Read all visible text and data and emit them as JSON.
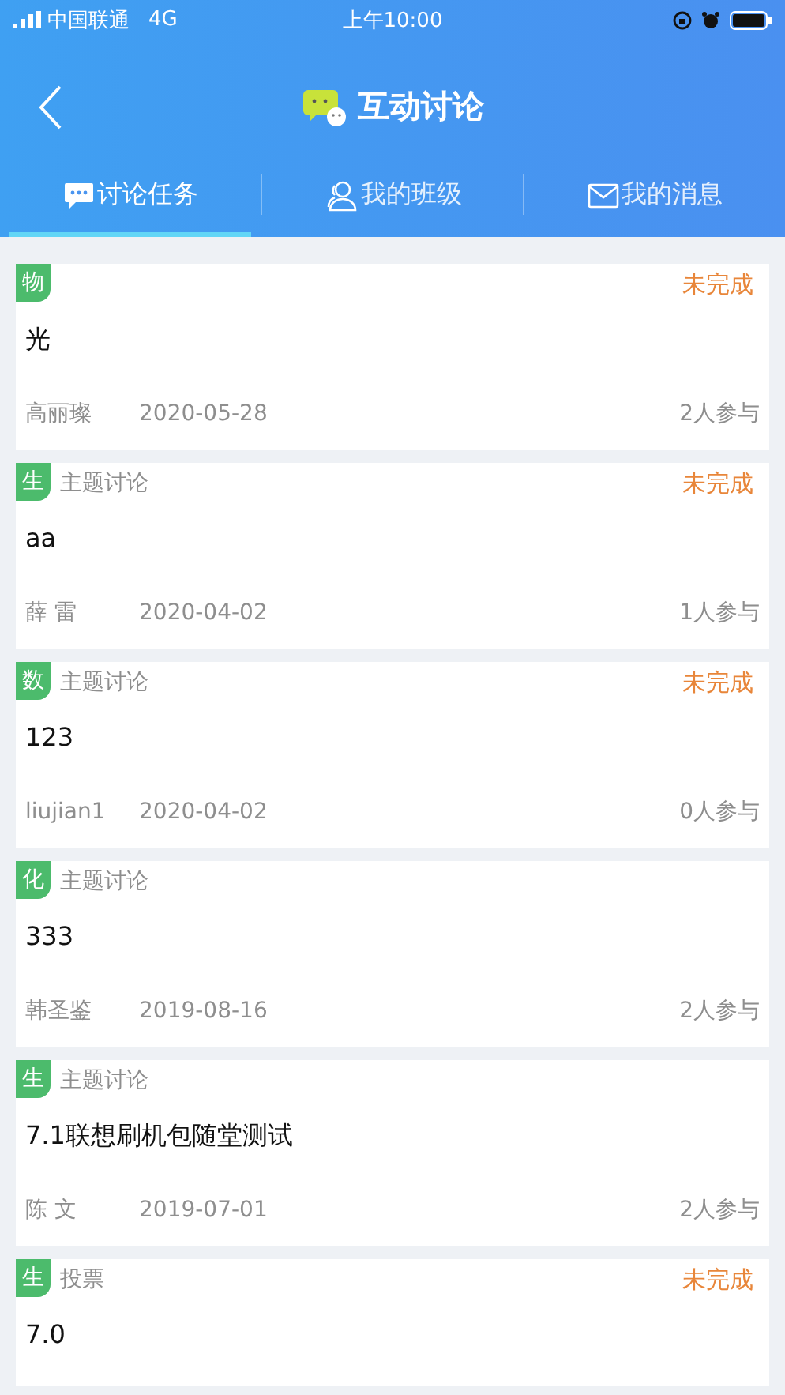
{
  "status_bar": {
    "carrier": "中国联通",
    "network": "4G",
    "time": "上午10:00"
  },
  "header": {
    "title": "互动讨论"
  },
  "tabs": [
    {
      "label": "讨论任务",
      "kind": "chat",
      "selected": true
    },
    {
      "label": "我的班级",
      "kind": "people",
      "selected": false
    },
    {
      "label": "我的消息",
      "kind": "mail",
      "selected": false
    }
  ],
  "topics": [
    {
      "subject": "物",
      "title": "光",
      "status": "未完成",
      "author": "高丽璨",
      "date": "2020-05-28",
      "participants": "2人参与"
    },
    {
      "subject": "生",
      "type": "主题讨论",
      "title": "aa",
      "status": "未完成",
      "author": "薛  雷",
      "date": "2020-04-02",
      "participants": "1人参与"
    },
    {
      "subject": "数",
      "type": "主题讨论",
      "title": "123",
      "status": "未完成",
      "author": "liujian1",
      "date": "2020-04-02",
      "participants": "0人参与"
    },
    {
      "subject": "化",
      "type": "主题讨论",
      "title": "333",
      "author": "韩圣鉴",
      "date": "2019-08-16",
      "participants": "2人参与"
    },
    {
      "subject": "生",
      "type": "主题讨论",
      "title": "7.1联想刷机包随堂测试",
      "author": "陈  文",
      "date": "2019-07-01",
      "participants": "2人参与"
    },
    {
      "subject": "生",
      "type": "投票",
      "title": "7.0",
      "status": "未完成"
    }
  ]
}
